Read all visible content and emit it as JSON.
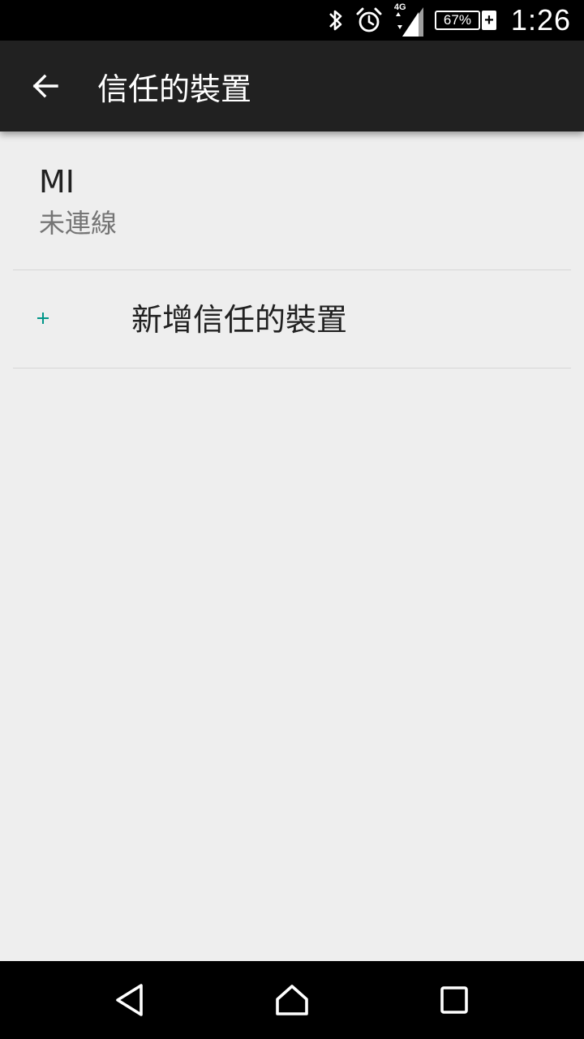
{
  "status_bar": {
    "network_type": "4G",
    "battery_percent": "67%",
    "battery_charging_symbol": "+",
    "time": "1:26",
    "icons": [
      "bluetooth-icon",
      "alarm-icon",
      "signal-icon",
      "battery-icon"
    ]
  },
  "toolbar": {
    "title": "信任的裝置",
    "back_icon": "arrow-back-icon"
  },
  "devices": [
    {
      "name": "MI",
      "status": "未連線"
    }
  ],
  "add_device": {
    "icon": "plus-icon",
    "label": "新增信任的裝置"
  },
  "colors": {
    "status_bar_bg": "#000000",
    "toolbar_bg": "#212121",
    "page_bg": "#eeeeee",
    "primary_text": "#212121",
    "secondary_text": "#757575",
    "accent": "#009688",
    "divider": "#d6d6d6"
  },
  "nav_bar": {
    "icons": [
      "back-triangle-icon",
      "home-icon",
      "recents-icon"
    ]
  }
}
